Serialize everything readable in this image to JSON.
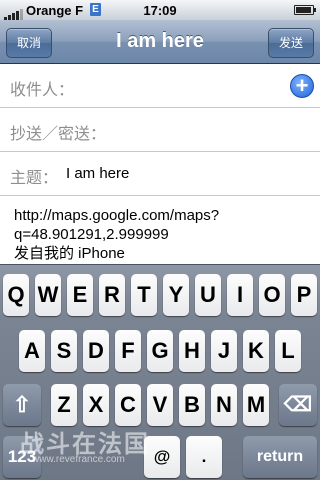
{
  "status": {
    "carrier": "Orange F",
    "network_badge": "E",
    "time": "17:09"
  },
  "nav": {
    "cancel_label": "取消",
    "title": "I am here",
    "send_label": "发送"
  },
  "form": {
    "to_label": "收件人：",
    "cc_label": "抄送／密送：",
    "subject_label": "主题：",
    "subject_value": "I am here",
    "add_contact_icon": "plus-circle-icon"
  },
  "message": {
    "line1": "http://maps.google.com/maps?",
    "line2": "q=48.901291,2.999999",
    "line3": "发自我的 iPhone"
  },
  "keyboard": {
    "row1": [
      "Q",
      "W",
      "E",
      "R",
      "T",
      "Y",
      "U",
      "I",
      "O",
      "P"
    ],
    "row2": [
      "A",
      "S",
      "D",
      "F",
      "G",
      "H",
      "J",
      "K",
      "L"
    ],
    "row3": [
      "Z",
      "X",
      "C",
      "V",
      "B",
      "N",
      "M"
    ],
    "key_123": "123",
    "key_at": "@",
    "key_dot": ".",
    "key_return": "return",
    "shift_icon": "shift-icon",
    "delete_icon": "backspace-icon"
  },
  "watermark": {
    "text": "战斗在法国",
    "url": "www.revefrance.com"
  },
  "colors": {
    "nav_bar": "#7990b0",
    "add_button": "#1f64d8",
    "keyboard": "#7c8594"
  }
}
